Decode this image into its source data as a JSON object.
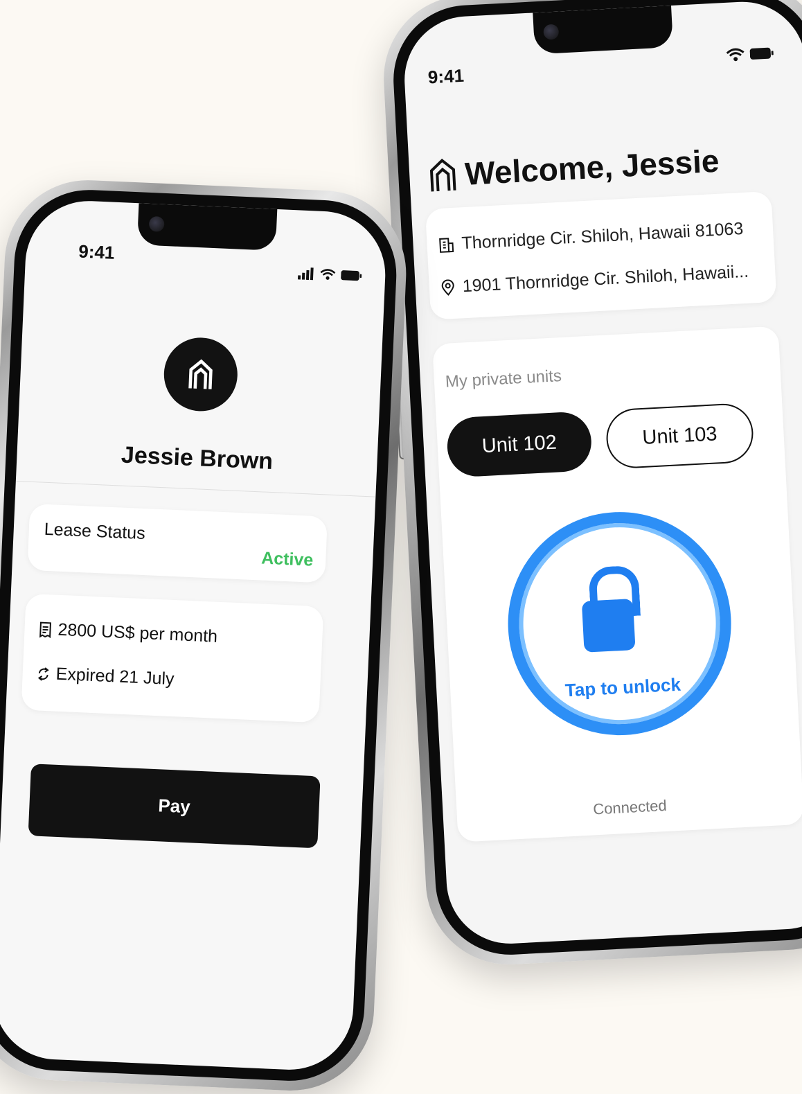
{
  "right_phone": {
    "status_time": "9:41",
    "welcome_title": "Welcome, Jessie",
    "building_name": "Thornridge Cir. Shiloh, Hawaii 81063",
    "address": "1901 Thornridge Cir. Shiloh, Hawaii...",
    "units_label": "My private units",
    "units": [
      {
        "label": "Unit 102",
        "selected": true
      },
      {
        "label": "Unit 103",
        "selected": false
      }
    ],
    "unlock_label": "Tap to unlock",
    "connection_status": "Connected",
    "colors": {
      "accent": "#2d8ff6",
      "lock": "#1f7ef0"
    }
  },
  "left_phone": {
    "status_time": "9:41",
    "profile_name": "Jessie Brown",
    "lease_status_label": "Lease Status",
    "lease_status_value": "Active",
    "rent": "2800 US$ per month",
    "expiry": "Expired 21 July",
    "pay_label": "Pay",
    "colors": {
      "active": "#3fbf5f",
      "button": "#121212"
    }
  },
  "icons": [
    "home-logo-icon",
    "building-icon",
    "location-pin-icon",
    "lock-icon",
    "receipt-icon",
    "refresh-icon",
    "wifi-icon",
    "battery-icon",
    "signal-icon"
  ]
}
